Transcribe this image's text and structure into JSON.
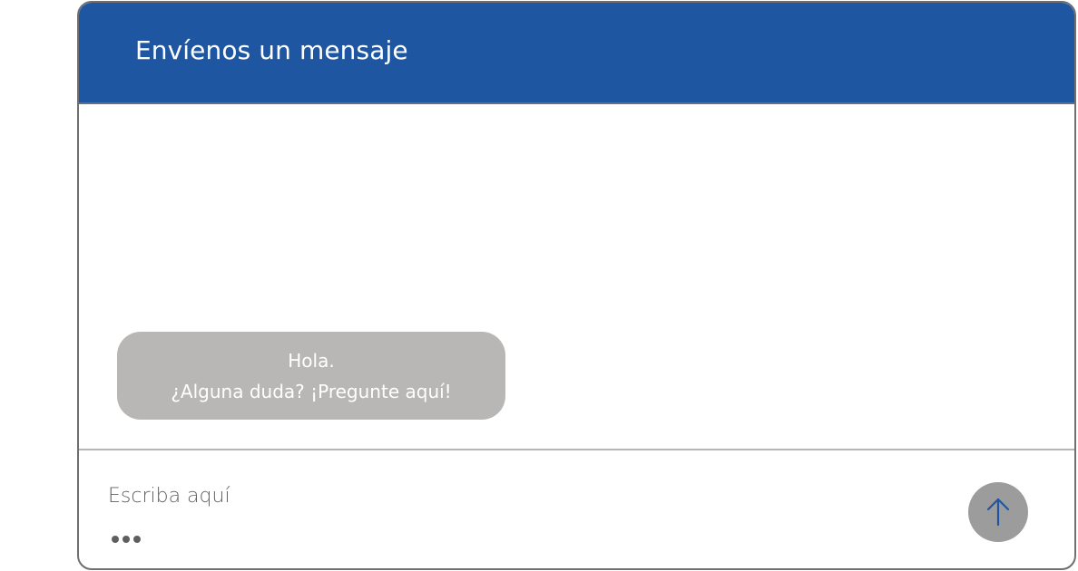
{
  "header": {
    "title": "Envíenos un mensaje"
  },
  "messages": [
    {
      "line1": "Hola.",
      "line2": "¿Alguna duda? ¡Pregunte aquí!"
    }
  ],
  "composer": {
    "placeholder": "Escriba aquí",
    "value": "",
    "send_icon": "arrow-up-icon",
    "typing_indicator_icon": "typing-dots-icon"
  },
  "colors": {
    "header_bg": "#1e56a2",
    "bubble_bg": "#b8b7b5",
    "send_button_bg": "#9d9c9c",
    "send_arrow": "#1e56a2",
    "border": "#6f6f72"
  }
}
